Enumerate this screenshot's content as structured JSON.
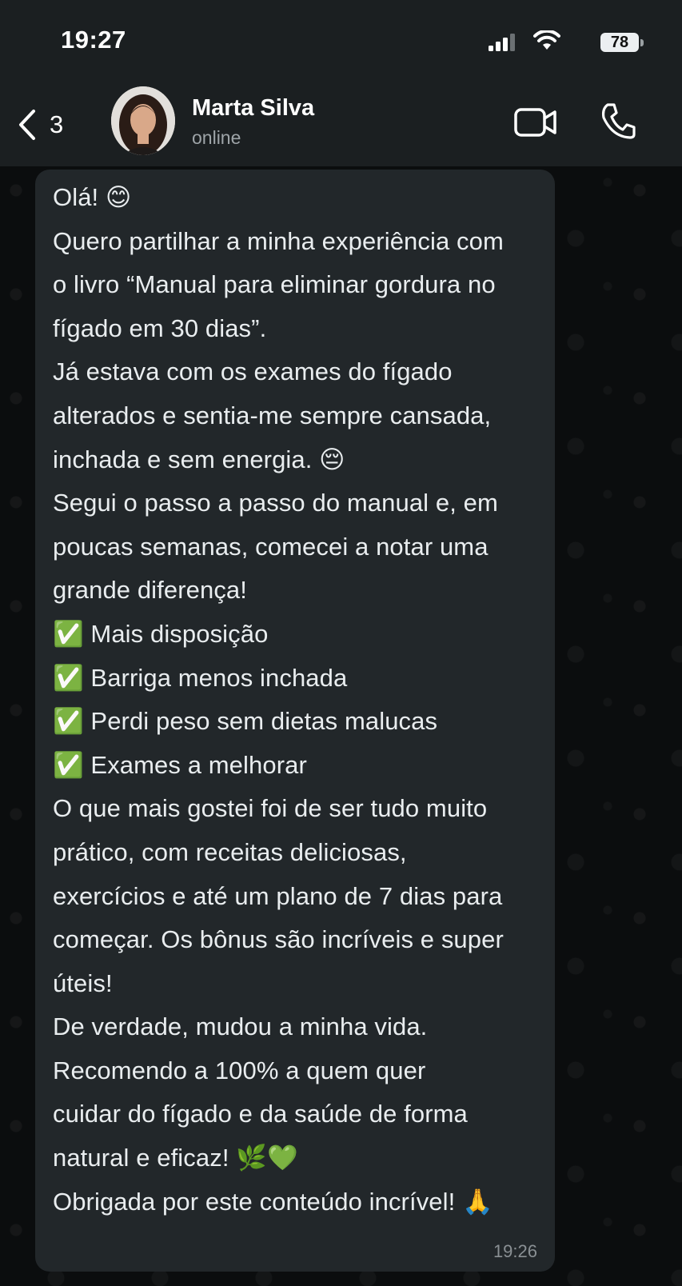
{
  "status_bar": {
    "time": "19:27",
    "battery": "78"
  },
  "header": {
    "back_count": "3",
    "contact_name": "Marta Silva",
    "contact_status": "online"
  },
  "message": {
    "lines": [
      "Olá! 😊",
      "Quero partilhar a minha experiência com",
      "o livro “Manual para eliminar gordura no",
      "fígado em 30 dias”.",
      "Já estava com os exames do fígado",
      "alterados e sentia-me sempre cansada,",
      "inchada e sem energia. 😔",
      "Segui o passo a passo do manual e, em",
      "poucas semanas, comecei a notar uma",
      "grande diferença!",
      "✅ Mais disposição",
      "✅ Barriga menos inchada",
      "✅ Perdi peso sem dietas malucas",
      "✅ Exames a melhorar",
      "O que mais gostei foi de ser tudo muito",
      "prático, com receitas deliciosas,",
      "exercícios e até um plano de 7 dias para",
      "começar. Os bônus são incríveis e super",
      "úteis!",
      "De verdade, mudou a minha vida.",
      "Recomendo a 100% a quem quer",
      "cuidar do fígado e da saúde de forma",
      "natural e eficaz! 🌿💚",
      "Obrigada por este conteúdo incrível! 🙏"
    ],
    "time": "19:26"
  },
  "icons": {
    "back": "chevron-left-icon",
    "video": "video-camera-icon",
    "call": "phone-icon"
  }
}
